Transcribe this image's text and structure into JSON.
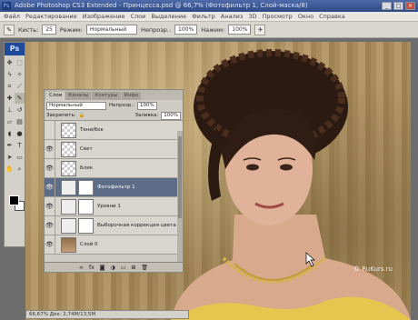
{
  "window": {
    "title": "Adobe Photoshop CS3 Extended - Принцесса.psd @ 66,7% (Фотофильтр 1, Слой-маска/8)",
    "buttons": {
      "minimize": "_",
      "maximize": "□",
      "close": "×"
    }
  },
  "menu": [
    "Файл",
    "Редактирование",
    "Изображение",
    "Слои",
    "Выделение",
    "Фильтр",
    "Анализ",
    "3D",
    "Просмотр",
    "Окно",
    "Справка"
  ],
  "options": {
    "tool_icon": "brush-icon",
    "brush_label": "Кисть:",
    "brush_size": "25",
    "mode_label": "Режим:",
    "mode_value": "Нормальный",
    "opacity_label": "Непрозр.:",
    "opacity_value": "100%",
    "flow_label": "Нажим:",
    "flow_value": "100%"
  },
  "toolbox": {
    "logo": "Ps"
  },
  "layers_panel": {
    "tabs": [
      "Слои",
      "Каналы",
      "Контуры",
      "Инфо"
    ],
    "blend_mode": "Нормальный",
    "opacity_label": "Непрозр.:",
    "opacity_value": "100%",
    "lock_label": "Закрепить:",
    "fill_label": "Заливка:",
    "fill_value": "100%",
    "layers": [
      {
        "name": "Тени/бок",
        "visible": false,
        "thumb": "transparent"
      },
      {
        "name": "Свет",
        "visible": true,
        "thumb": "transparent"
      },
      {
        "name": "Блик",
        "visible": true,
        "thumb": "transparent"
      },
      {
        "name": "Фотофильтр 1",
        "visible": true,
        "thumb": "adjustment",
        "selected": true
      },
      {
        "name": "Уровни 1",
        "visible": true,
        "thumb": "adjustment"
      },
      {
        "name": "Выборочная коррекция цвета 1",
        "visible": true,
        "thumb": "adjustment"
      },
      {
        "name": "Слой 0",
        "visible": true,
        "thumb": "photo"
      }
    ]
  },
  "status": "66,67%   Док: 2,74M/13,5M",
  "watermark": "© RuKurs.ru"
}
